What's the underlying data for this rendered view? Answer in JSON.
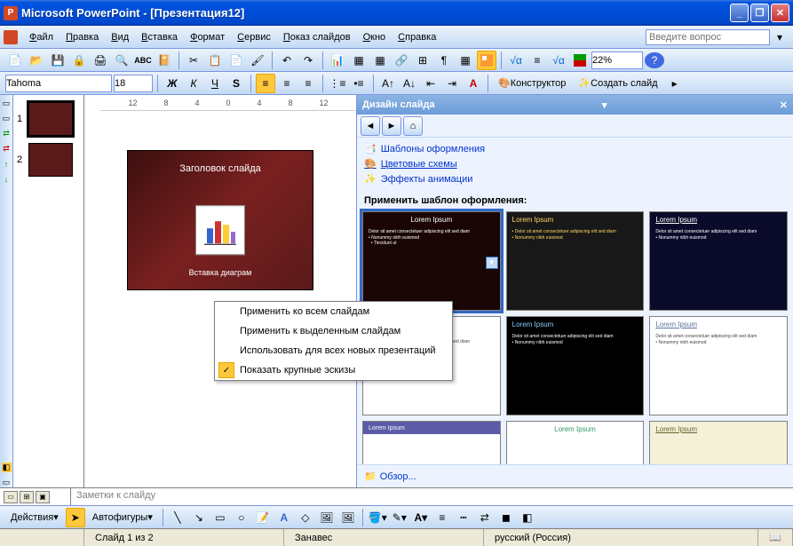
{
  "titlebar": {
    "app": "Microsoft PowerPoint",
    "doc": "[Презентация12]"
  },
  "menubar": {
    "items": [
      "Файл",
      "Правка",
      "Вид",
      "Вставка",
      "Формат",
      "Сервис",
      "Показ слайдов",
      "Окно",
      "Справка"
    ],
    "ask_placeholder": "Введите вопрос"
  },
  "toolbar1": {
    "zoom": "22%"
  },
  "toolbar2": {
    "font": "Tahoma",
    "size": "18",
    "designer": "Конструктор",
    "newslide": "Создать слайд"
  },
  "ruler": [
    "12",
    "8",
    "4",
    "0",
    "4",
    "8",
    "12"
  ],
  "thumbs": [
    {
      "num": "1"
    },
    {
      "num": "2"
    }
  ],
  "slide": {
    "title": "Заголовок слайда",
    "subtitle": "Вставка диаграм"
  },
  "context_menu": {
    "items": [
      "Применить ко всем слайдам",
      "Применить к выделенным слайдам",
      "Использовать для всех новых презентаций",
      "Показать крупные эскизы"
    ]
  },
  "taskpane": {
    "title": "Дизайн слайда",
    "links": {
      "templates": "Шаблоны оформления",
      "colors": "Цветовые схемы",
      "anim": "Эффекты анимации"
    },
    "section": "Применить шаблон оформления:",
    "lorem_title": "Lorem Ipsum",
    "lorem_title_u": "Lorem Ipsum",
    "lorem_body1": "Delor sit amet consectetuer adipiscing elit sed diam",
    "lorem_body2": "Nonummy nibh euismod",
    "lorem_body3": "Tincidunt ut",
    "review": "Обзор..."
  },
  "notes": {
    "placeholder": "Заметки к слайду"
  },
  "drawbar": {
    "actions": "Действия",
    "autoshapes": "Автофигуры"
  },
  "statusbar": {
    "slide": "Слайд 1 из 2",
    "theme": "Занавес",
    "lang": "русский (Россия)"
  }
}
